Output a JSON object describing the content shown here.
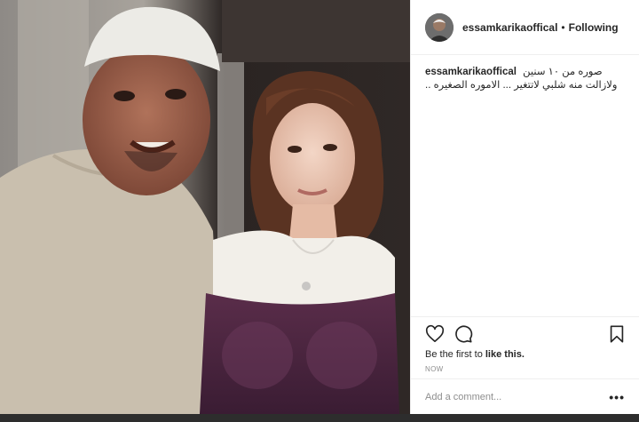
{
  "post": {
    "username": "essamkarikaoffical",
    "separator": "•",
    "follow_status": "Following",
    "caption_user": "essamkarikaoffical",
    "caption_text": "صوره من ١٠ سنين ولازالت منه شلبي لاتتغير ... الاموره الصغيره ..",
    "likes_prefix": "Be the first to ",
    "likes_link": "like this.",
    "timestamp": "NOW",
    "comment_placeholder": "Add a comment...",
    "more_label": "•••"
  },
  "icons": {
    "like": "heart-icon",
    "comment": "comment-icon",
    "save": "bookmark-icon",
    "more": "more-options-icon"
  },
  "colors": {
    "panel_bg": "#ffffff",
    "text": "#262626",
    "muted": "#8e8e8e",
    "border": "#efefef"
  }
}
